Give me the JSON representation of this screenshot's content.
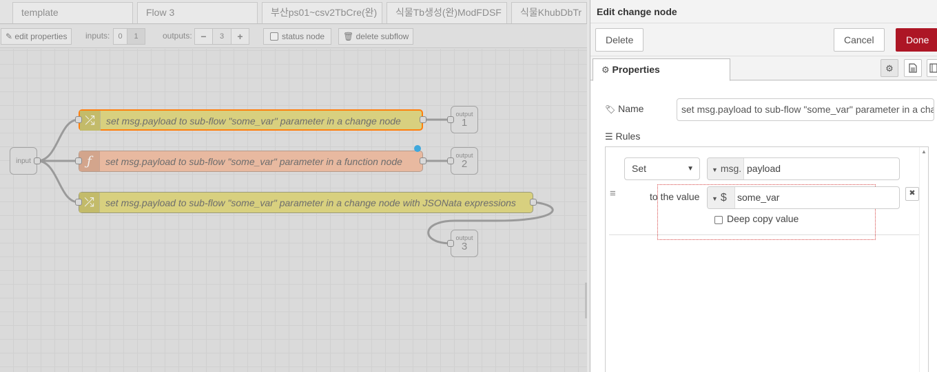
{
  "tabs": [
    {
      "label": "template"
    },
    {
      "label": "Flow 3"
    },
    {
      "label": "부산ps01~csv2TbCre(완)"
    },
    {
      "label": "식물Tb생성(완)ModFDSF"
    },
    {
      "label": "식물KhubDbTr"
    }
  ],
  "subflow_bar": {
    "edit_properties": "edit properties",
    "inputs_label": "inputs:",
    "inputs_options": [
      "0",
      "1"
    ],
    "outputs_label": "outputs:",
    "outputs_minus": "−",
    "outputs_value": "3",
    "outputs_plus": "+",
    "status_node": "status node",
    "delete_subflow": "delete subflow"
  },
  "canvas": {
    "input_node": "input",
    "nodes": [
      {
        "label": "set msg.payload to sub-flow \"some_var\" parameter in a change node",
        "type": "change",
        "icon": "shuffle-icon"
      },
      {
        "label": "set msg.payload to sub-flow \"some_var\" parameter in a function node",
        "type": "function",
        "icon": "function-icon",
        "icon_glyph": "ƒ"
      },
      {
        "label": "set msg.payload to sub-flow \"some_var\" parameter in a change node with JSONata expressions",
        "type": "change",
        "icon": "shuffle-icon"
      }
    ],
    "outputs": [
      {
        "label": "output",
        "num": "1"
      },
      {
        "label": "output",
        "num": "2"
      },
      {
        "label": "output",
        "num": "3"
      }
    ]
  },
  "tray": {
    "title": "Edit change node",
    "delete": "Delete",
    "cancel": "Cancel",
    "done": "Done",
    "properties_tab": "Properties",
    "name_label": "Name",
    "name_value": "set msg.payload to sub-flow \"some_var\" parameter in a change node",
    "rules_label": "Rules",
    "rule": {
      "action": "Set",
      "target_type": "msg.",
      "target_value": "payload",
      "to_the_value": "to the value",
      "value_type": "$",
      "value": "some_var",
      "deep_copy": "Deep copy value"
    }
  },
  "colors": {
    "change_node": "#d8d07f",
    "function_node": "#e8b9a0",
    "done_button": "#ad1625",
    "selection_outline": "#ff7f0e",
    "changed_dot": "#3fa8dc"
  }
}
